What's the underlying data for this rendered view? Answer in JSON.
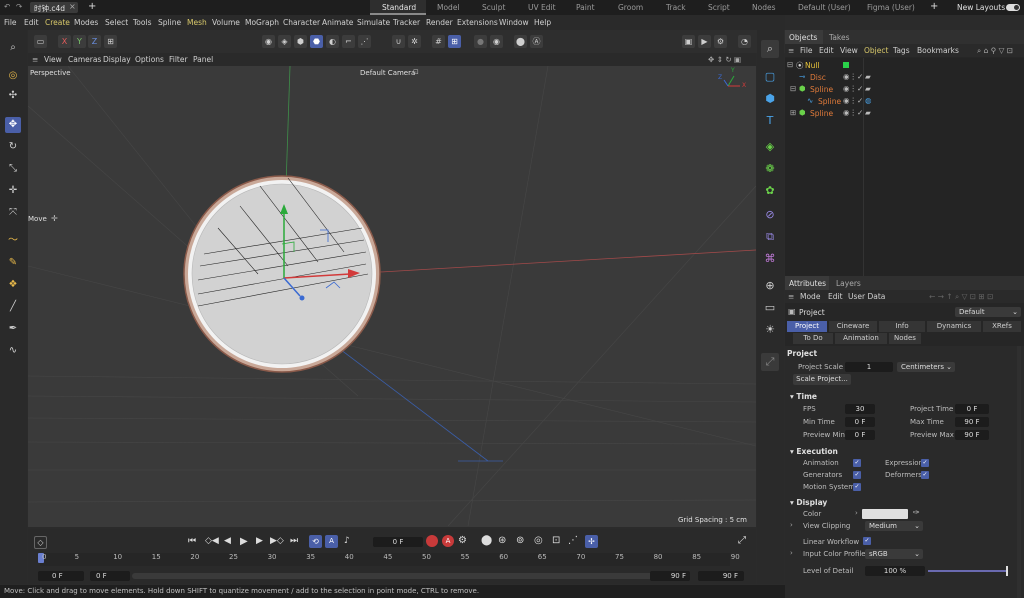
{
  "titlebar": {
    "file_tab": "时钟.c4d",
    "layouts": [
      "Standard",
      "Model",
      "Sculpt",
      "UV Edit",
      "Paint",
      "Groom",
      "Track",
      "Script",
      "Nodes",
      "Default (User)",
      "Figma (User)"
    ],
    "new_layouts": "New Layouts"
  },
  "menubar": [
    "File",
    "Edit",
    "Create",
    "Modes",
    "Select",
    "Tools",
    "Spline",
    "Mesh",
    "Volume",
    "MoGraph",
    "Character",
    "Animate",
    "Simulate",
    "Tracker",
    "Render",
    "Extensions",
    "Window",
    "Help"
  ],
  "axis_buttons": [
    "X",
    "Y",
    "Z"
  ],
  "viewmenu": [
    "View",
    "Cameras",
    "Display",
    "Options",
    "Filter",
    "Panel"
  ],
  "viewport": {
    "label": "Perspective",
    "camera": "Default Camera",
    "move_label": "Move",
    "grid_spacing": "Grid Spacing : 5 cm",
    "axis_y": "Y",
    "axis_x": "X",
    "axis_z": "Z"
  },
  "timeline": {
    "frame_field": "0 F",
    "ruler": [
      "0",
      "5",
      "10",
      "15",
      "20",
      "25",
      "30",
      "35",
      "40",
      "45",
      "50",
      "55",
      "60",
      "65",
      "70",
      "75",
      "80",
      "85",
      "90"
    ],
    "start_field": "0 F",
    "start_field2": "0 F",
    "end_field": "90 F",
    "end_field2": "90 F"
  },
  "status": "Move: Click and drag to move elements. Hold down SHIFT to quantize movement / add to the selection in point mode, CTRL to remove.",
  "objects": {
    "tabs": [
      "Objects",
      "Takes"
    ],
    "menu": [
      "File",
      "Edit",
      "View",
      "Object",
      "Tags",
      "Bookmarks"
    ],
    "items": [
      {
        "name": "Null",
        "color": "#e8c43a"
      },
      {
        "name": "Disc",
        "color": "#e07a3a"
      },
      {
        "name": "Spline",
        "color": "#e07a3a"
      },
      {
        "name": "Spline",
        "color": "#e07a3a"
      },
      {
        "name": "Spline",
        "color": "#e07a3a"
      }
    ]
  },
  "attributes": {
    "tabs": [
      "Attributes",
      "Layers"
    ],
    "menu": [
      "Mode",
      "Edit",
      "User Data"
    ],
    "object_label": "Project",
    "preset": "Default",
    "tab_row1": [
      "Project",
      "Cineware",
      "Info",
      "Dynamics",
      "XRefs"
    ],
    "tab_row2": [
      "To Do",
      "Animation",
      "Nodes"
    ],
    "section_project": "Project",
    "project_scale_label": "Project Scale",
    "project_scale_value": "1",
    "project_scale_unit": "Centimeters",
    "scale_project_btn": "Scale Project...",
    "section_time": "Time",
    "fps_label": "FPS",
    "fps_value": "30",
    "project_time_label": "Project Time",
    "project_time_value": "0 F",
    "min_time_label": "Min Time",
    "min_time_value": "0 F",
    "max_time_label": "Max Time",
    "max_time_value": "90 F",
    "preview_min_label": "Preview Min",
    "preview_min_value": "0 F",
    "preview_max_label": "Preview Max",
    "preview_max_value": "90 F",
    "section_execution": "Execution",
    "animation_label": "Animation",
    "expression_label": "Expression",
    "generators_label": "Generators",
    "deformers_label": "Deformers",
    "motion_system_label": "Motion System",
    "section_display": "Display",
    "color_label": "Color",
    "view_clipping_label": "View Clipping",
    "view_clipping_value": "Medium",
    "linear_workflow_label": "Linear Workflow",
    "input_color_profile_label": "Input Color Profile",
    "input_color_profile_value": "sRGB",
    "lod_label": "Level of Detail",
    "lod_value": "100 %"
  }
}
